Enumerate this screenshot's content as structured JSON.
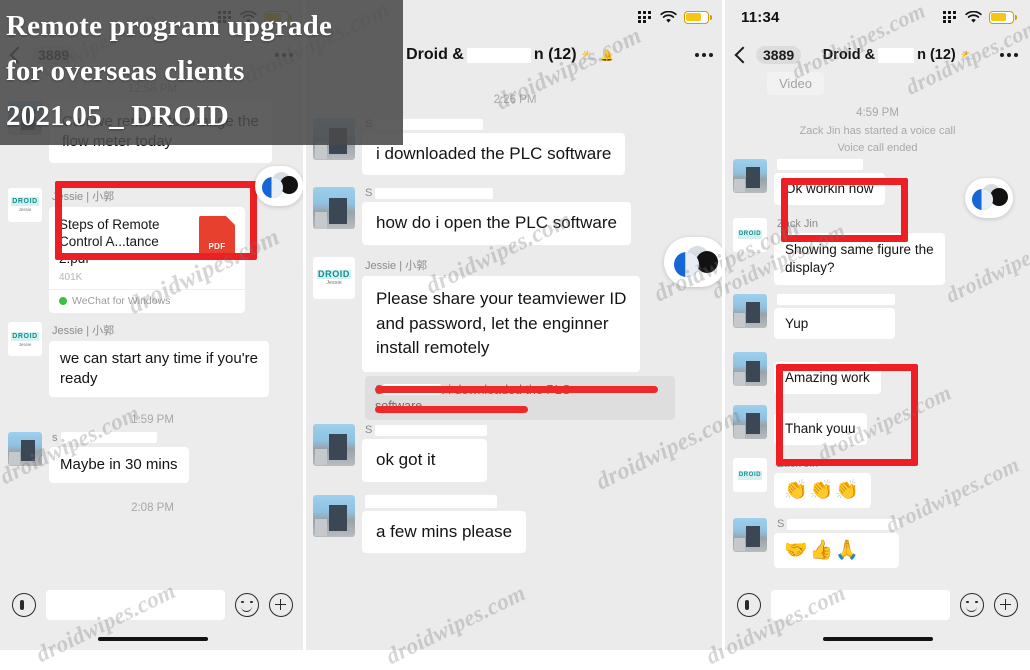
{
  "overlay_title": {
    "line1": "Remote program upgrade",
    "line2": "for overseas clients",
    "line3": "2021.05 _ DROID"
  },
  "watermark": {
    "text": "droidwipes.com"
  },
  "icons": {
    "signal": "signal-dots-icon",
    "wifi": "wifi-icon",
    "battery": "battery-low-power-icon",
    "back": "chevron-left-icon",
    "more": "more-options-icon",
    "voice": "voice-record-icon",
    "emoji": "emoji-icon",
    "plus": "plus-icon",
    "pdf": "pdf-file-icon",
    "wechat": "wechat-dot-icon"
  },
  "panel1": {
    "statusbar": {
      "time": "",
      "battery_pct": "64"
    },
    "header": {
      "back_count": "3889",
      "title_left": "",
      "title_right": "",
      "mute": "",
      "bell": ""
    },
    "timestamps": {
      "t1": "12:58 PM",
      "t2": "1:59 PM",
      "t3": "2:08 PM"
    },
    "messages": {
      "m1": "Can we remote to change the\nflow meter today",
      "m2_sender": "Jessie | 小郭",
      "m2_file_name": "Steps of Remote\nControl A...tance 2.pdf",
      "m2_file_size": "401K",
      "m2_file_source": "WeChat for Windows",
      "m3_sender": "Jessie | 小郭",
      "m3": "we can start any time if you're\nready",
      "m4": "Maybe in 30 mins"
    },
    "input": {
      "placeholder": ""
    }
  },
  "panel2": {
    "statusbar": {
      "time": "",
      "battery_pct": "64"
    },
    "header": {
      "back_count": "",
      "title_left": "Droid &",
      "title_right": "n (12)"
    },
    "timestamps": {
      "t1": "2:26 PM"
    },
    "messages": {
      "m1": "i downloaded the PLC software",
      "m2": "how do i open the PLC software",
      "m3_sender": "Jessie | 小郭",
      "m3": "Please share your teamviewer ID\nand password, let the enginner\ninstall remotely",
      "m4_quote_suffix": ": i downloaded the PLC",
      "m4_quote_line2": "software",
      "m5": "ok got it",
      "m6": "a few mins please"
    }
  },
  "panel3": {
    "statusbar": {
      "time": "11:34",
      "battery_pct": "64"
    },
    "header": {
      "back_count": "3889",
      "title_left": "Droid &",
      "title_right": "n (12)"
    },
    "timestamps": {
      "t1": "4:59 PM"
    },
    "system": {
      "call_started": "Zack Jin has started a voice call",
      "call_ended": "Voice call ended"
    },
    "messages": {
      "m0_partial": "Video",
      "m1": "Ok workin now",
      "m2_sender": "Zack Jin",
      "m2": "Showing same figure the\ndisplay?",
      "m3": "Yup",
      "m4": "Amazing work",
      "m5": "Thank youu",
      "m6_sender": "Zack Jin",
      "m6_emoji": "👏👏👏",
      "m7_emoji": "🤝👍🙏"
    },
    "input": {
      "placeholder": ""
    }
  },
  "colors": {
    "annotation_red": "#ec2024",
    "bubble_white": "#ffffff",
    "chat_bg": "#ececed",
    "overlay_gray": "#4a4a4a",
    "battery_yellow": "#f5c518"
  }
}
